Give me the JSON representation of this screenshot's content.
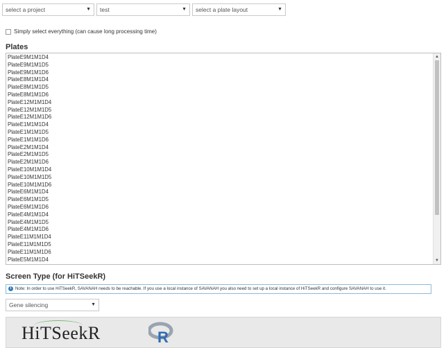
{
  "selects": {
    "project": "select a project",
    "test": "test",
    "layout": "select a plate layout",
    "screen_type": "Gene silencing"
  },
  "checkbox": {
    "label": "Simply select everything (can cause long processing time)"
  },
  "plates": {
    "title": "Plates",
    "items": [
      "PlateE9M1M1D4",
      "PlateE9M1M1D5",
      "PlateE9M1M1D6",
      "PlateE8M1M1D4",
      "PlateE8M1M1D5",
      "PlateE8M1M1D6",
      "PlateE12M1M1D4",
      "PlateE12M1M1D5",
      "PlateE12M1M1D6",
      "PlateE1M1M1D4",
      "PlateE1M1M1D5",
      "PlateE1M1M1D6",
      "PlateE2M1M1D4",
      "PlateE2M1M1D5",
      "PlateE2M1M1D6",
      "PlateE10M1M1D4",
      "PlateE10M1M1D5",
      "PlateE10M1M1D6",
      "PlateE6M1M1D4",
      "PlateE6M1M1D5",
      "PlateE6M1M1D6",
      "PlateE4M1M1D4",
      "PlateE4M1M1D5",
      "PlateE4M1M1D6",
      "PlateE11M1M1D4",
      "PlateE11M1M1D5",
      "PlateE11M1M1D6",
      "PlateE5M1M1D4"
    ]
  },
  "screen_type": {
    "title": "Screen Type (for HiTSeekR)",
    "note": "Note: In order to use HiTSeekR, SAVANAH needs to be reachable. If you use a local instance of SAVANAH you also need to set up a local instance of HiTSeekR and configure SAVANAH to use it."
  },
  "logos": {
    "hitseekr": "HiTSeekR",
    "r": "R"
  },
  "icons": {
    "select_arrow": "chevron-down-icon",
    "info": "info-icon"
  }
}
